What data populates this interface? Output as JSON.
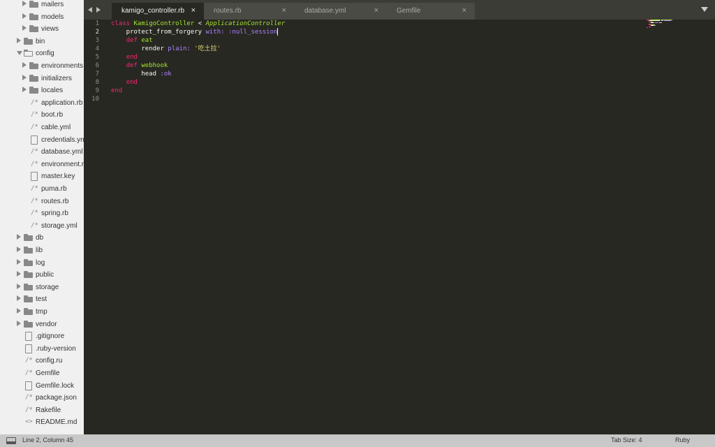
{
  "sidebar": {
    "items": [
      {
        "label": "mailers",
        "kind": "folder",
        "indent": 2,
        "expanded": false
      },
      {
        "label": "models",
        "kind": "folder",
        "indent": 2,
        "expanded": false
      },
      {
        "label": "views",
        "kind": "folder",
        "indent": 2,
        "expanded": false
      },
      {
        "label": "bin",
        "kind": "folder",
        "indent": 1,
        "expanded": false
      },
      {
        "label": "config",
        "kind": "folder",
        "indent": 1,
        "expanded": true
      },
      {
        "label": "environments",
        "kind": "folder",
        "indent": 2,
        "expanded": false
      },
      {
        "label": "initializers",
        "kind": "folder",
        "indent": 2,
        "expanded": false
      },
      {
        "label": "locales",
        "kind": "folder",
        "indent": 2,
        "expanded": false
      },
      {
        "label": "application.rb",
        "kind": "code",
        "indent": 2
      },
      {
        "label": "boot.rb",
        "kind": "code",
        "indent": 2
      },
      {
        "label": "cable.yml",
        "kind": "code",
        "indent": 2
      },
      {
        "label": "credentials.yml.enc",
        "kind": "doc",
        "indent": 2
      },
      {
        "label": "database.yml",
        "kind": "code",
        "indent": 2
      },
      {
        "label": "environment.rb",
        "kind": "code",
        "indent": 2
      },
      {
        "label": "master.key",
        "kind": "doc",
        "indent": 2
      },
      {
        "label": "puma.rb",
        "kind": "code",
        "indent": 2
      },
      {
        "label": "routes.rb",
        "kind": "code",
        "indent": 2
      },
      {
        "label": "spring.rb",
        "kind": "code",
        "indent": 2
      },
      {
        "label": "storage.yml",
        "kind": "code",
        "indent": 2
      },
      {
        "label": "db",
        "kind": "folder",
        "indent": 1,
        "expanded": false
      },
      {
        "label": "lib",
        "kind": "folder",
        "indent": 1,
        "expanded": false
      },
      {
        "label": "log",
        "kind": "folder",
        "indent": 1,
        "expanded": false
      },
      {
        "label": "public",
        "kind": "folder",
        "indent": 1,
        "expanded": false
      },
      {
        "label": "storage",
        "kind": "folder",
        "indent": 1,
        "expanded": false
      },
      {
        "label": "test",
        "kind": "folder",
        "indent": 1,
        "expanded": false
      },
      {
        "label": "tmp",
        "kind": "folder",
        "indent": 1,
        "expanded": false
      },
      {
        "label": "vendor",
        "kind": "folder",
        "indent": 1,
        "expanded": false
      },
      {
        "label": ".gitignore",
        "kind": "doc",
        "indent": 1
      },
      {
        "label": ".ruby-version",
        "kind": "doc",
        "indent": 1
      },
      {
        "label": "config.ru",
        "kind": "code",
        "indent": 1
      },
      {
        "label": "Gemfile",
        "kind": "code",
        "indent": 1
      },
      {
        "label": "Gemfile.lock",
        "kind": "doc",
        "indent": 1
      },
      {
        "label": "package.json",
        "kind": "code",
        "indent": 1
      },
      {
        "label": "Rakefile",
        "kind": "code",
        "indent": 1
      },
      {
        "label": "README.md",
        "kind": "markup",
        "indent": 1
      }
    ]
  },
  "tabs": [
    {
      "label": "kamigo_controller.rb",
      "active": true,
      "close": "×"
    },
    {
      "label": "routes.rb",
      "active": false,
      "close": "×"
    },
    {
      "label": "database.yml",
      "active": false,
      "close": "×"
    },
    {
      "label": "Gemfile",
      "active": false,
      "close": "×"
    }
  ],
  "editor": {
    "current_line": 2,
    "lines": [
      [
        {
          "t": "class ",
          "c": "kw"
        },
        {
          "t": "KamigoController",
          "c": "cls"
        },
        {
          "t": " < ",
          "c": "plain"
        },
        {
          "t": "ApplicationController",
          "c": "inh"
        }
      ],
      [
        {
          "t": "    protect_from_forgery ",
          "c": "plain"
        },
        {
          "t": "with:",
          "c": "sym"
        },
        {
          "t": " ",
          "c": "plain"
        },
        {
          "t": ":null_session",
          "c": "sym"
        },
        {
          "t": "",
          "c": "caret"
        }
      ],
      [
        {
          "t": "    ",
          "c": "plain"
        },
        {
          "t": "def",
          "c": "kw"
        },
        {
          "t": " ",
          "c": "plain"
        },
        {
          "t": "eat",
          "c": "fn"
        }
      ],
      [
        {
          "t": "        render ",
          "c": "plain"
        },
        {
          "t": "plain:",
          "c": "sym"
        },
        {
          "t": " ",
          "c": "plain"
        },
        {
          "t": "'吃土拉'",
          "c": "str"
        }
      ],
      [
        {
          "t": "    ",
          "c": "plain"
        },
        {
          "t": "end",
          "c": "kw"
        }
      ],
      [
        {
          "t": "    ",
          "c": "plain"
        },
        {
          "t": "def",
          "c": "kw"
        },
        {
          "t": " ",
          "c": "plain"
        },
        {
          "t": "webhook",
          "c": "fn"
        }
      ],
      [
        {
          "t": "        head ",
          "c": "plain"
        },
        {
          "t": ":ok",
          "c": "sym"
        }
      ],
      [
        {
          "t": "    ",
          "c": "plain"
        },
        {
          "t": "end",
          "c": "kw"
        }
      ],
      [
        {
          "t": "end",
          "c": "kw"
        }
      ],
      []
    ]
  },
  "colors": {
    "kw": "#f92672",
    "cls": "#a6e22e",
    "inh": "#a6e22e",
    "fn": "#a6e22e",
    "sym": "#ae81ff",
    "str": "#e6db74",
    "plain": "#f8f8f2"
  },
  "statusbar": {
    "position": "Line 2, Column 45",
    "tab_size": "Tab Size: 4",
    "syntax": "Ruby"
  }
}
